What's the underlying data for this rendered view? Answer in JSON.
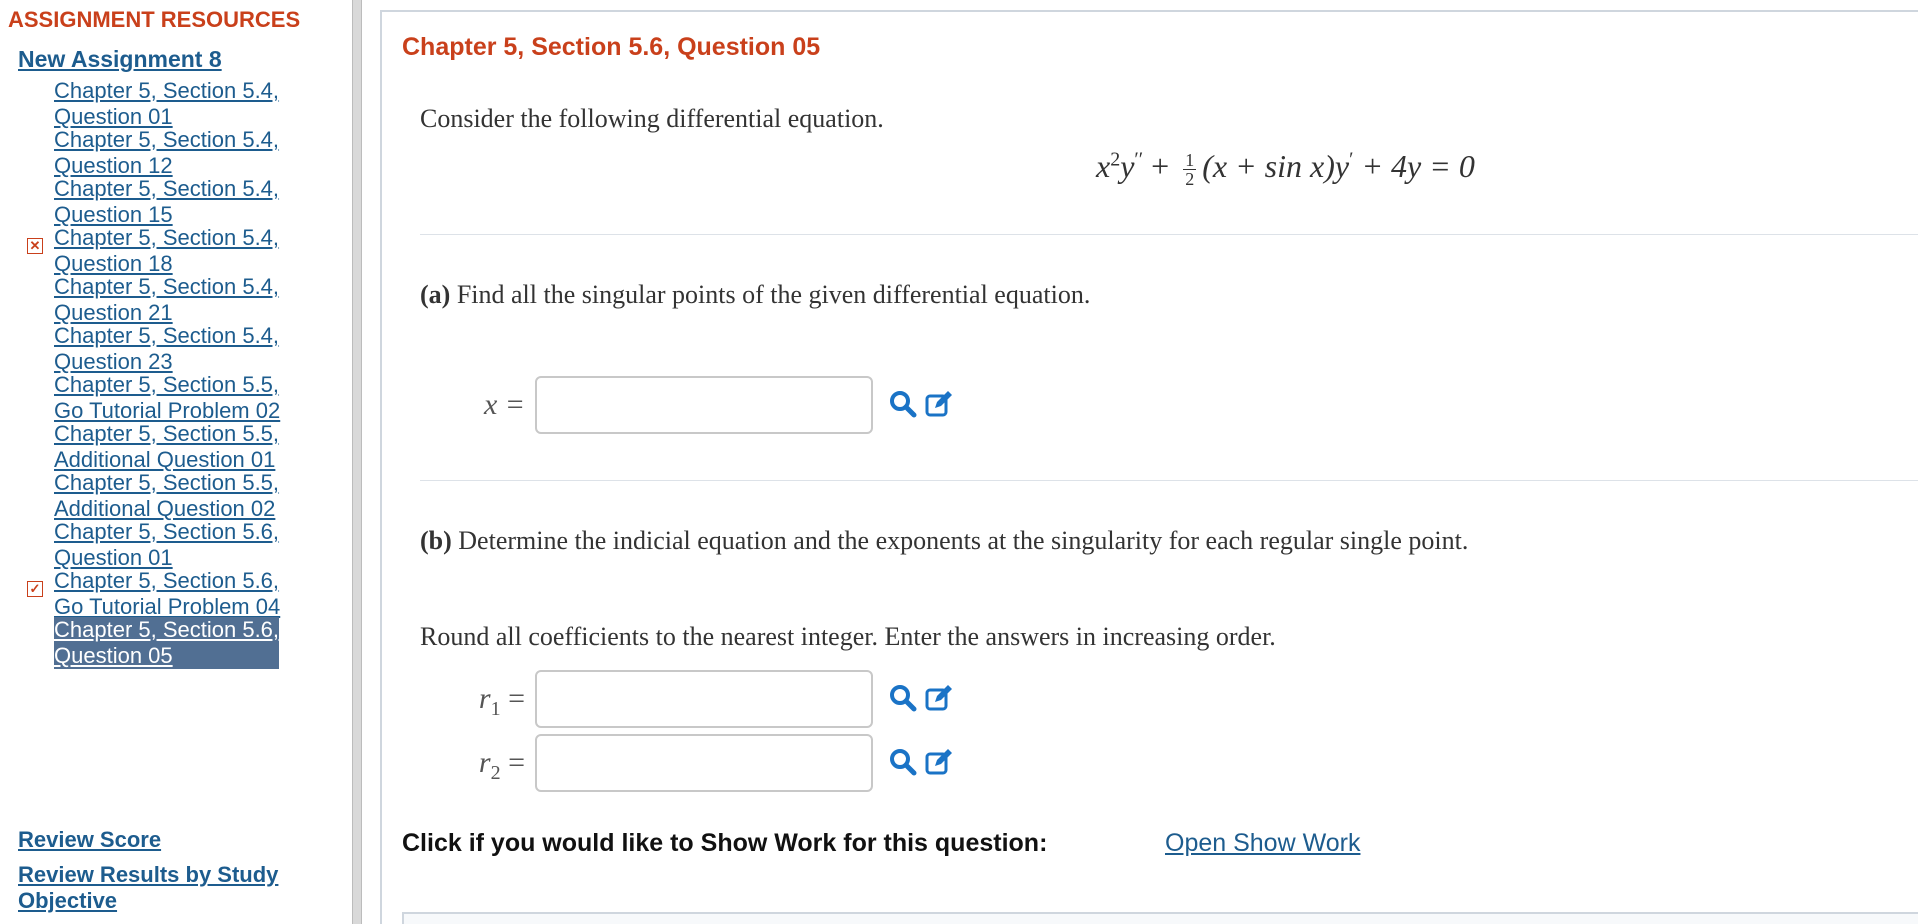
{
  "sidebar": {
    "title": "ASSIGNMENT RESOURCES",
    "assignment": "New Assignment 8",
    "items": [
      {
        "label": "Chapter 5, Section 5.4,\nQuestion 01",
        "status": "",
        "active": false
      },
      {
        "label": "Chapter 5, Section 5.4,\nQuestion 12",
        "status": "",
        "active": false
      },
      {
        "label": "Chapter 5, Section 5.4,\nQuestion 15",
        "status": "",
        "active": false
      },
      {
        "label": "Chapter 5, Section 5.4,\nQuestion 18",
        "status": "incorrect",
        "active": false
      },
      {
        "label": "Chapter 5, Section 5.4,\nQuestion 21",
        "status": "",
        "active": false
      },
      {
        "label": "Chapter 5, Section 5.4,\nQuestion 23",
        "status": "",
        "active": false
      },
      {
        "label": "Chapter 5, Section 5.5,\nGo Tutorial Problem 02",
        "status": "",
        "active": false
      },
      {
        "label": "Chapter 5, Section 5.5,\nAdditional Question 01",
        "status": "",
        "active": false
      },
      {
        "label": "Chapter 5, Section 5.5,\nAdditional Question 02",
        "status": "",
        "active": false
      },
      {
        "label": "Chapter 5, Section 5.6,\nQuestion 01",
        "status": "",
        "active": false
      },
      {
        "label": "Chapter 5, Section 5.6,\nGo Tutorial Problem 04",
        "status": "partial",
        "active": false
      },
      {
        "label": "Chapter 5, Section 5.6,\nQuestion 05",
        "status": "",
        "active": true
      }
    ],
    "review_score": "Review Score",
    "review_results": "Review Results by Study Objective"
  },
  "question": {
    "title": "Chapter 5, Section 5.6, Question 05",
    "intro": "Consider the following differential equation.",
    "part_a_label": "(a)",
    "part_a_text": " Find all the singular points of the given differential equation.",
    "x_label": "x =",
    "x_value": "",
    "part_b_label": "(b)",
    "part_b_text": " Determine the indicial equation and the exponents at the singularity for each regular single point.",
    "round_note": "Round all coefficients to the nearest integer. Enter the answers in increasing order.",
    "r1_sub": "1",
    "r2_sub": "2",
    "r_label": "r",
    "equals": "=",
    "r1_value": "",
    "r2_value": ""
  },
  "equation": {
    "x": "x",
    "exp2": "2",
    "y": "y",
    "dprime": "′′",
    "plus1": " + ",
    "frac_num": "1",
    "frac_den": "2",
    "paren": "(x + sin x)y",
    "prime": "′",
    "rest": " + 4y = 0"
  },
  "show_work": {
    "label": "Click if you would like to Show Work for this question:",
    "link": "Open Show Work"
  },
  "colors": {
    "accent": "#c9401b",
    "link": "#1d5c8e",
    "active_bg": "#516f93",
    "tool_icon": "#1a73c6"
  },
  "icons": [
    "search-icon",
    "edit-icon",
    "incorrect-x-icon",
    "partial-check-icon"
  ]
}
